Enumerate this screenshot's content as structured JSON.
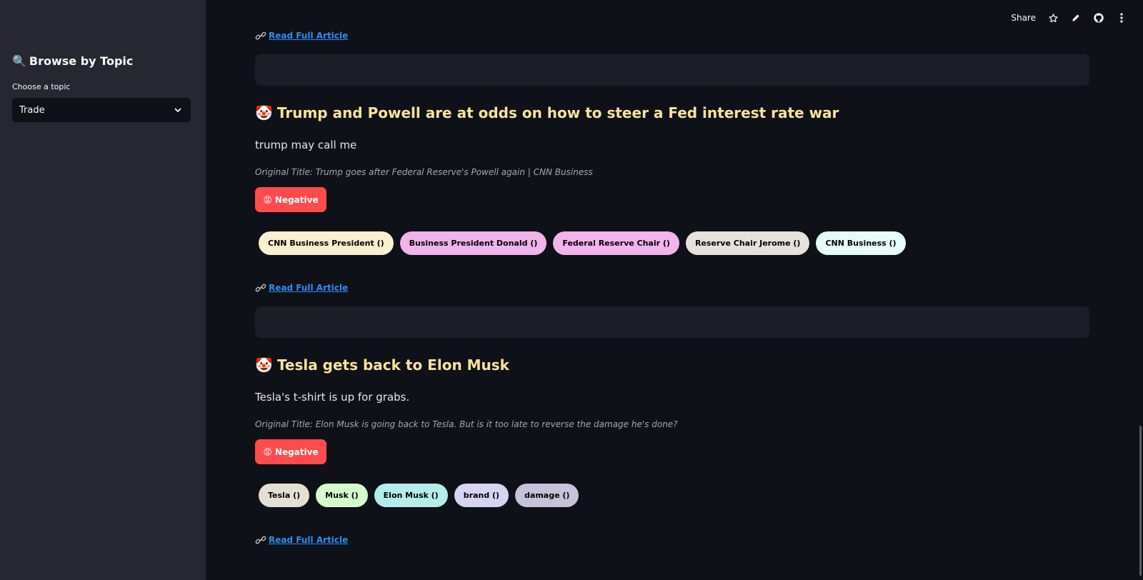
{
  "sidebar": {
    "title_icon": "🔍",
    "title": "Browse by Topic",
    "select_label": "Choose a topic",
    "select_value": "Trade"
  },
  "toolbar": {
    "share_label": "Share",
    "icons": [
      "star-icon",
      "edit-pencil-icon",
      "github-icon",
      "more-vertical-icon"
    ]
  },
  "read_more_label": "Read Full Article",
  "articles": [
    {
      "emoji": "🤡",
      "title": "Trump and Powell are at odds on how to steer a Fed interest rate war",
      "summary": "trump may call me",
      "original_title": "Original Title: Trump goes after Federal Reserve's Powell again | CNN Business",
      "sentiment_emoji": "😡",
      "sentiment": "Negative",
      "entities": [
        {
          "label": "CNN Business President ()",
          "color": "#f9f0d0"
        },
        {
          "label": "Business President Donald ()",
          "color": "#f0b3ea"
        },
        {
          "label": "Federal Reserve Chair ()",
          "color": "#f3b3eb"
        },
        {
          "label": "Reserve Chair Jerome ()",
          "color": "#e6e1dc"
        },
        {
          "label": "CNN Business ()",
          "color": "#e6fdf7"
        }
      ]
    },
    {
      "emoji": "🤡",
      "title": "Tesla gets back to Elon Musk",
      "summary": "Tesla's t-shirt is up for grabs.",
      "original_title": "Original Title: Elon Musk is going back to Tesla. But is it too late to reverse the damage he's done?",
      "sentiment_emoji": "😡",
      "sentiment": "Negative",
      "entities": [
        {
          "label": "Tesla ()",
          "color": "#e3e0d3"
        },
        {
          "label": "Musk ()",
          "color": "#d3fdcc"
        },
        {
          "label": "Elon Musk ()",
          "color": "#b5ecec"
        },
        {
          "label": "brand ()",
          "color": "#d7d3f3"
        },
        {
          "label": "damage ()",
          "color": "#c5c2d9"
        }
      ]
    }
  ]
}
